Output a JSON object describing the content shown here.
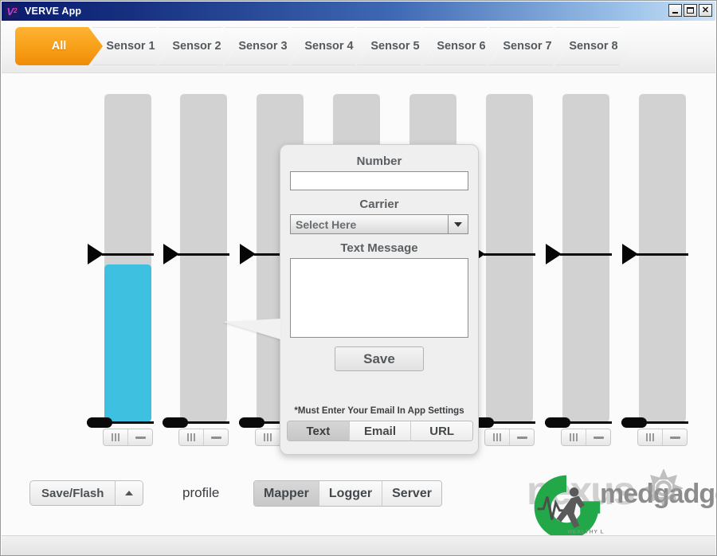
{
  "window": {
    "title": "VERVE App",
    "icon": "v2-logo-icon",
    "minimize_label": "_",
    "maximize_label": "□",
    "close_label": "✕"
  },
  "tabs": [
    {
      "label": "All",
      "active": true
    },
    {
      "label": "Sensor 1",
      "active": false
    },
    {
      "label": "Sensor 2",
      "active": false
    },
    {
      "label": "Sensor 3",
      "active": false
    },
    {
      "label": "Sensor 4",
      "active": false
    },
    {
      "label": "Sensor 5",
      "active": false
    },
    {
      "label": "Sensor 6",
      "active": false
    },
    {
      "label": "Sensor 7",
      "active": false
    },
    {
      "label": "Sensor 8",
      "active": false
    }
  ],
  "sensors": [
    {
      "index": 1,
      "fill_percent": 47,
      "fill_color": "#3ec0e0",
      "track_color": "#d2d2d2"
    },
    {
      "index": 2,
      "fill_percent": 0,
      "fill_color": "#3ec0e0",
      "track_color": "#d2d2d2"
    },
    {
      "index": 3,
      "fill_percent": 0,
      "fill_color": "#3ec0e0",
      "track_color": "#d2d2d2"
    },
    {
      "index": 4,
      "fill_percent": 0,
      "fill_color": "#3ec0e0",
      "track_color": "#d2d2d2"
    },
    {
      "index": 5,
      "fill_percent": 0,
      "fill_color": "#3ec0e0",
      "track_color": "#d2d2d2"
    },
    {
      "index": 6,
      "fill_percent": 0,
      "fill_color": "#3ec0e0",
      "track_color": "#d2d2d2"
    },
    {
      "index": 7,
      "fill_percent": 0,
      "fill_color": "#3ec0e0",
      "track_color": "#d2d2d2"
    },
    {
      "index": 8,
      "fill_percent": 0,
      "fill_color": "#3ec0e0",
      "track_color": "#d2d2d2"
    }
  ],
  "sensor_controls": {
    "bars_icon": "bars-icon",
    "dash_icon": "dash-icon"
  },
  "popup": {
    "number_label": "Number",
    "number_value": "",
    "number_placeholder": "",
    "carrier_label": "Carrier",
    "carrier_selected": "Select Here",
    "carrier_caret": "chevron-down-icon",
    "message_label": "Text Message",
    "message_value": "",
    "message_placeholder": "",
    "save_label": "Save",
    "note": "*Must Enter Your Email In App Settings",
    "modes": [
      {
        "label": "Text",
        "active": true
      },
      {
        "label": "Email",
        "active": false
      },
      {
        "label": "URL",
        "active": false
      }
    ]
  },
  "bottom": {
    "save_flash_label": "Save/Flash",
    "save_flash_caret": "chevron-up-icon",
    "profile_label": "profile",
    "modes": [
      {
        "label": "Mapper",
        "active": true
      },
      {
        "label": "Logger",
        "active": false
      },
      {
        "label": "Server",
        "active": false
      }
    ]
  },
  "watermark": {
    "background_text": "nexus",
    "brand_text": "medgadgets",
    "tagline": "HEALTHY LIVING",
    "logo_icon": "running-man-logo-icon",
    "gear_icon": "gear-icon",
    "brand_green": "#22a848"
  }
}
